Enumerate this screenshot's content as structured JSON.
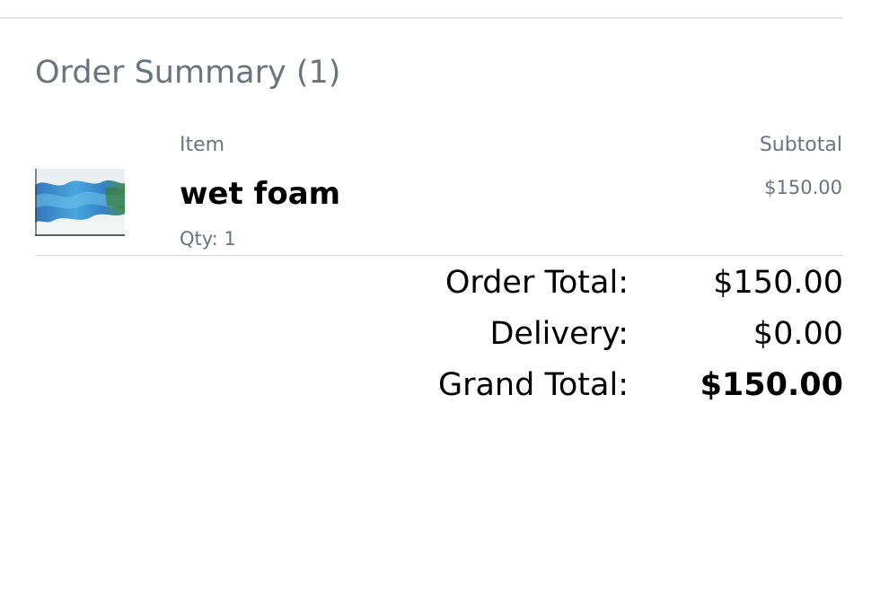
{
  "summary": {
    "title": "Order Summary (1)"
  },
  "table": {
    "headers": {
      "item": "Item",
      "subtotal": "Subtotal"
    },
    "items": [
      {
        "name": "wet foam",
        "qty": "Qty: 1",
        "subtotal": "$150.00",
        "thumbnail": "abstract-blue-painting-image"
      }
    ]
  },
  "totals": {
    "order_total_label": "Order Total:",
    "order_total_value": "$150.00",
    "delivery_label": "Delivery:",
    "delivery_value": "$0.00",
    "grand_total_label": "Grand Total:",
    "grand_total_value": "$150.00"
  },
  "colors": {
    "muted_text": "#6b737b",
    "divider": "#e4e6e8",
    "primary_text": "#000000"
  }
}
